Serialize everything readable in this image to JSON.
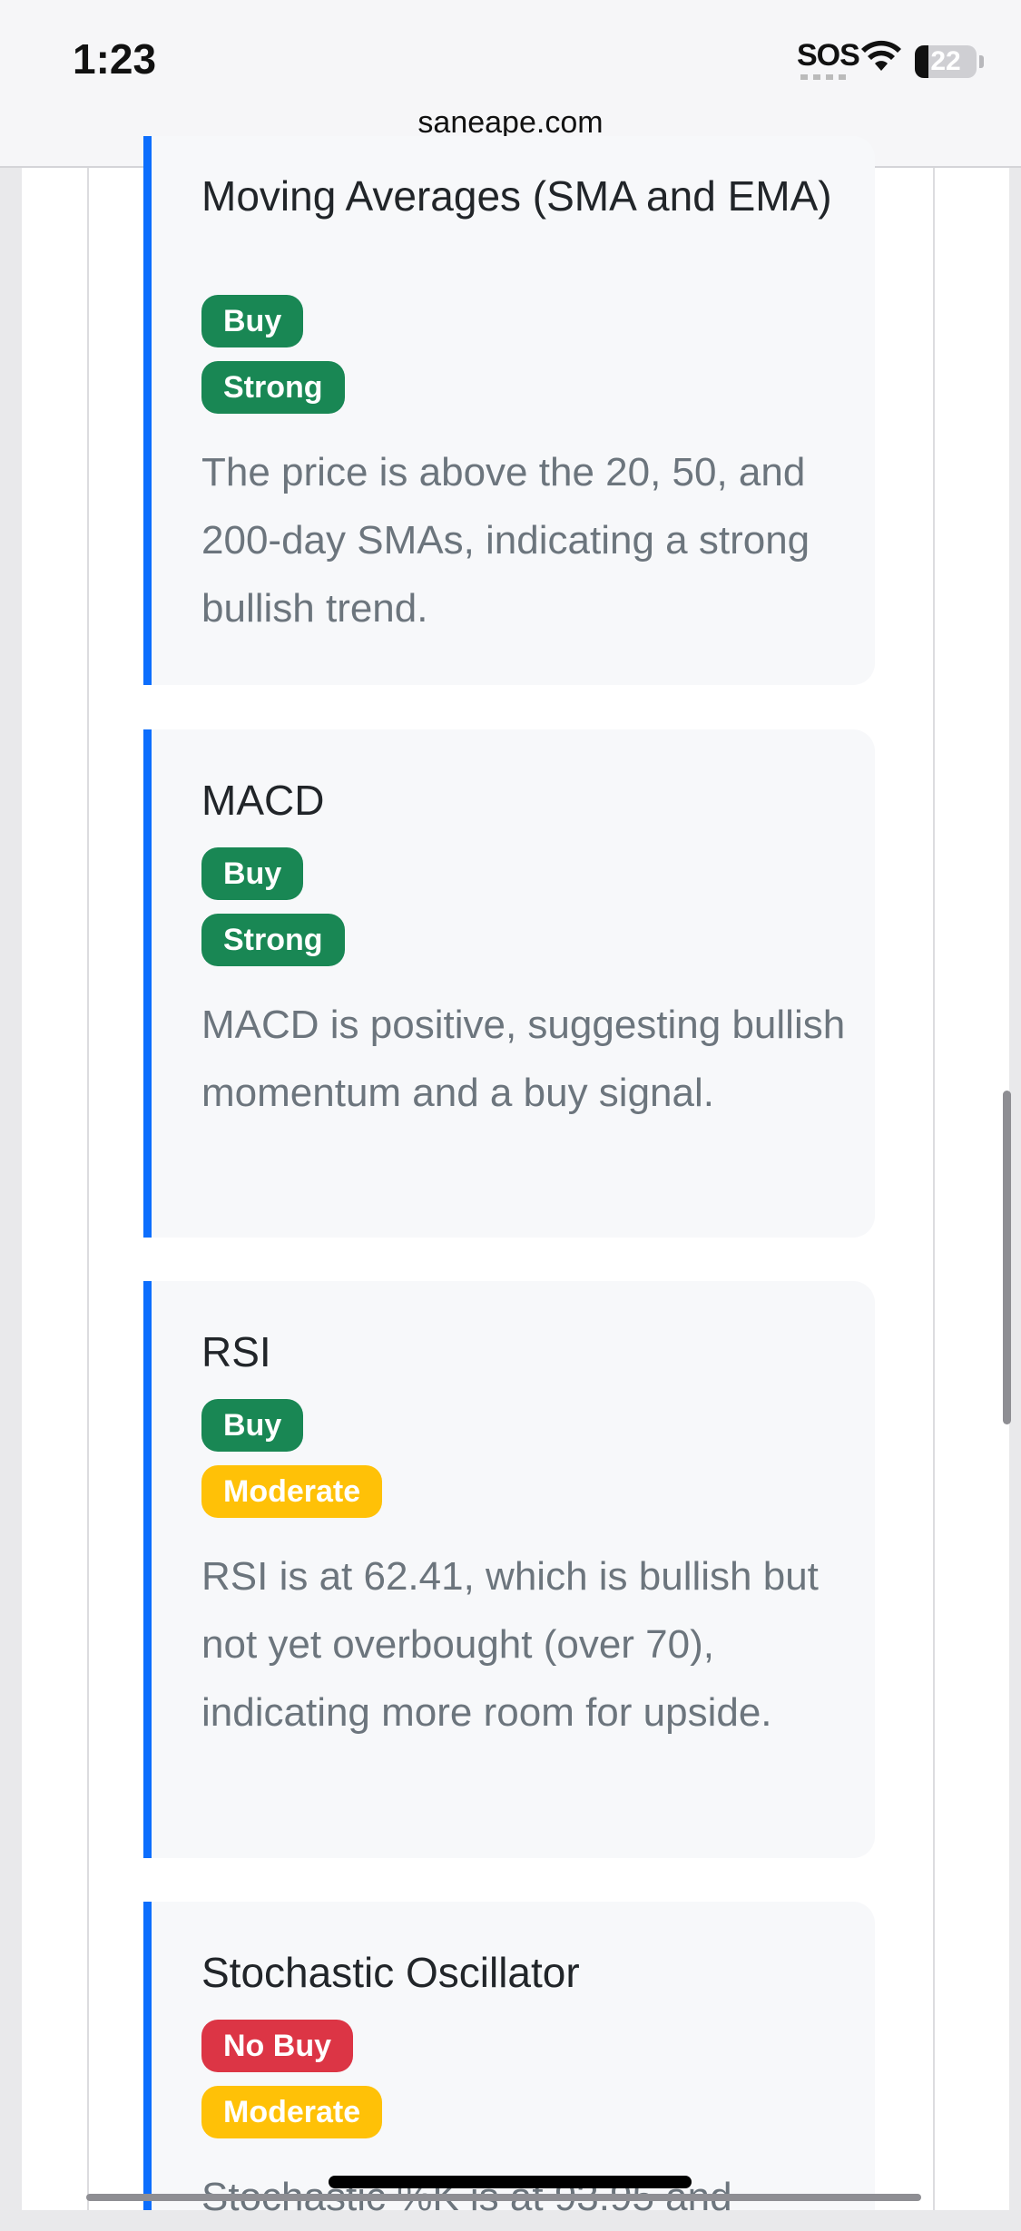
{
  "status_bar": {
    "time": "1:23",
    "sos": "SOS",
    "battery": "22",
    "url": "saneape.com"
  },
  "indicators": [
    {
      "title": "Moving Averages (SMA and EMA)",
      "signal": "Buy",
      "strength": "Strong",
      "description": "The price is above the 20, 50, and 200-day SMAs, indicating a strong bullish trend."
    },
    {
      "title": "MACD",
      "signal": "Buy",
      "strength": "Strong",
      "description": "MACD is positive, suggesting bullish momentum and a buy signal."
    },
    {
      "title": "RSI",
      "signal": "Buy",
      "strength": "Moderate",
      "description": "RSI is at 62.41, which is bullish but not yet overbought (over 70), indicating more room for upside."
    },
    {
      "title": "Stochastic Oscillator",
      "signal": "No Buy",
      "strength": "Moderate",
      "description": "Stochastic %K is at 93.95 and"
    }
  ],
  "colors": {
    "accent": "#0d6efd",
    "buy": "#198754",
    "strong": "#198754",
    "moderate": "#ffc107",
    "no_buy": "#dc3545"
  },
  "icons": [
    "wifi-icon",
    "battery-icon"
  ]
}
